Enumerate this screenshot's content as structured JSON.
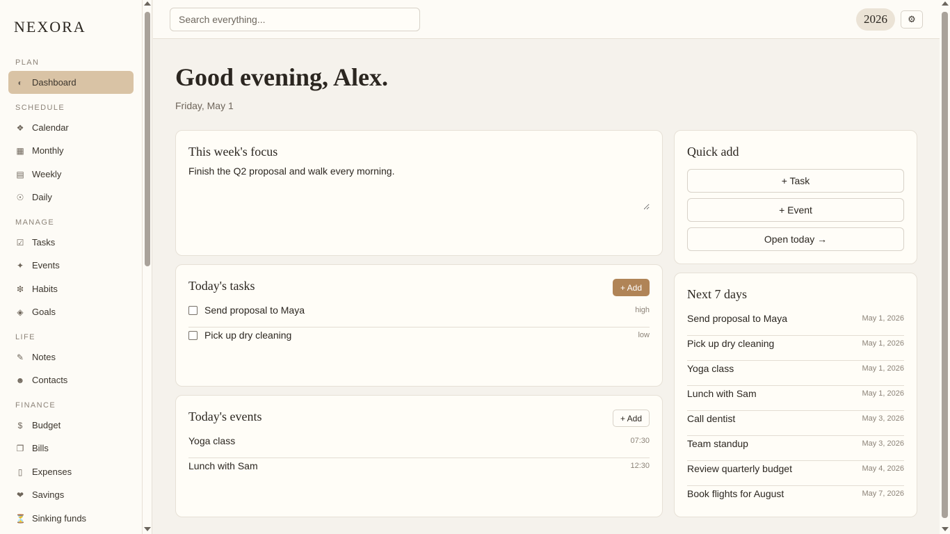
{
  "brand": "NEXORA",
  "sidebar": {
    "sections": [
      {
        "label": "PLAN",
        "items": [
          {
            "label": "Dashboard",
            "icon": "◐"
          }
        ]
      },
      {
        "label": "SCHEDULE",
        "items": [
          {
            "label": "Calendar",
            "icon": "❖"
          },
          {
            "label": "Monthly",
            "icon": "▦"
          },
          {
            "label": "Weekly",
            "icon": "▤"
          },
          {
            "label": "Daily",
            "icon": "☉"
          }
        ]
      },
      {
        "label": "MANAGE",
        "items": [
          {
            "label": "Tasks",
            "icon": "☑"
          },
          {
            "label": "Events",
            "icon": "✦"
          },
          {
            "label": "Habits",
            "icon": "❇"
          },
          {
            "label": "Goals",
            "icon": "◈"
          }
        ]
      },
      {
        "label": "LIFE",
        "items": [
          {
            "label": "Notes",
            "icon": "✎"
          },
          {
            "label": "Contacts",
            "icon": "☻"
          }
        ]
      },
      {
        "label": "FINANCE",
        "items": [
          {
            "label": "Budget",
            "icon": "$"
          },
          {
            "label": "Bills",
            "icon": "❐"
          },
          {
            "label": "Expenses",
            "icon": "▯"
          },
          {
            "label": "Savings",
            "icon": "❤"
          },
          {
            "label": "Sinking funds",
            "icon": "⏳"
          }
        ]
      }
    ],
    "active": "Dashboard"
  },
  "header": {
    "search_placeholder": "Search everything...",
    "year": "2026",
    "settings_icon": "⚙"
  },
  "greeting": "Good evening, Alex.",
  "date": "Friday, May 1",
  "focus": {
    "title": "This week's focus",
    "text": "Finish the Q2 proposal and walk every morning."
  },
  "tasks": {
    "title": "Today's tasks",
    "add_label": "+ Add",
    "items": [
      {
        "label": "Send proposal to Maya",
        "priority": "high"
      },
      {
        "label": "Pick up dry cleaning",
        "priority": "low"
      }
    ]
  },
  "events": {
    "title": "Today's events",
    "add_label": "+ Add",
    "items": [
      {
        "label": "Yoga class",
        "time": "07:30"
      },
      {
        "label": "Lunch with Sam",
        "time": "12:30"
      }
    ]
  },
  "quick_add": {
    "title": "Quick add",
    "task_label": "+ Task",
    "event_label": "+ Event",
    "open_today_label": "Open today →"
  },
  "upcoming": {
    "title": "Next 7 days",
    "items": [
      {
        "label": "Send proposal to Maya",
        "date": "May 1, 2026"
      },
      {
        "label": "Pick up dry cleaning",
        "date": "May 1, 2026"
      },
      {
        "label": "Yoga class",
        "date": "May 1, 2026"
      },
      {
        "label": "Lunch with Sam",
        "date": "May 1, 2026"
      },
      {
        "label": "Call dentist",
        "date": "May 3, 2026"
      },
      {
        "label": "Team standup",
        "date": "May 3, 2026"
      },
      {
        "label": "Review quarterly budget",
        "date": "May 4, 2026"
      },
      {
        "label": "Book flights for August",
        "date": "May 7, 2026"
      }
    ]
  },
  "colors": {
    "accent": "#b08457",
    "active_nav": "#d9c3a5",
    "background": "#f5f2ec",
    "card": "#fffdf7"
  }
}
